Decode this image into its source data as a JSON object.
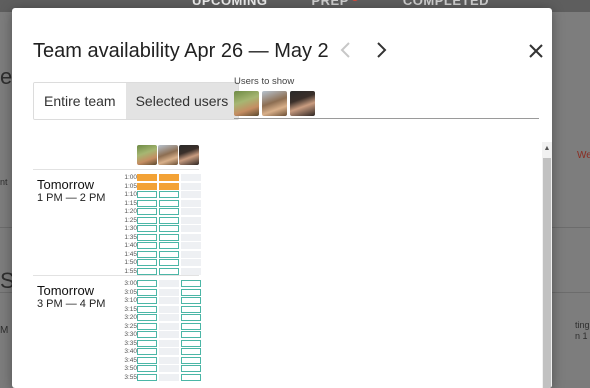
{
  "background": {
    "tabs": [
      {
        "label": "UPCOMING",
        "active": true
      },
      {
        "label": "PREP",
        "active": false,
        "badge": true
      },
      {
        "label": "COMPLETED",
        "active": false
      }
    ],
    "fragments": {
      "left_e": "e",
      "left_nt": "nt",
      "left_s": "S",
      "left_m": "M",
      "right_we": "We",
      "right_ting": "ting",
      "right_ting2": "n 1"
    }
  },
  "modal": {
    "title": "Team availability Apr 26 — May 2",
    "prev_icon": "chevron-left-icon",
    "next_icon": "chevron-right-icon",
    "close_icon": "close-icon",
    "toggle": {
      "entire_team": "Entire team",
      "selected_users": "Selected users",
      "selected": "selected_users"
    },
    "users_label": "Users to show",
    "users": [
      "user-1",
      "user-2",
      "user-3"
    ]
  },
  "colors": {
    "busy": "#f3a235",
    "free": "#4bb6a6",
    "none": "#eef0f3"
  },
  "schedule": [
    {
      "day": "Tomorrow",
      "range": "1 PM — 2 PM",
      "rows": [
        {
          "time": "1:00",
          "cells": [
            "busy",
            "busy",
            "none"
          ]
        },
        {
          "time": "1:05",
          "cells": [
            "busy",
            "busy",
            "none"
          ]
        },
        {
          "time": "1:10",
          "cells": [
            "free",
            "free",
            "none"
          ]
        },
        {
          "time": "1:15",
          "cells": [
            "free",
            "free",
            "none"
          ]
        },
        {
          "time": "1:20",
          "cells": [
            "free",
            "free",
            "none"
          ]
        },
        {
          "time": "1:25",
          "cells": [
            "free",
            "free",
            "none"
          ]
        },
        {
          "time": "1:30",
          "cells": [
            "free",
            "free",
            "none"
          ]
        },
        {
          "time": "1:35",
          "cells": [
            "free",
            "free",
            "none"
          ]
        },
        {
          "time": "1:40",
          "cells": [
            "free",
            "free",
            "none"
          ]
        },
        {
          "time": "1:45",
          "cells": [
            "free",
            "free",
            "none"
          ]
        },
        {
          "time": "1:50",
          "cells": [
            "free",
            "free",
            "none"
          ]
        },
        {
          "time": "1:55",
          "cells": [
            "free",
            "free",
            "none"
          ]
        }
      ]
    },
    {
      "day": "Tomorrow",
      "range": "3 PM — 4 PM",
      "rows": [
        {
          "time": "3:00",
          "cells": [
            "free",
            "none",
            "free"
          ]
        },
        {
          "time": "3:05",
          "cells": [
            "free",
            "none",
            "free"
          ]
        },
        {
          "time": "3:10",
          "cells": [
            "free",
            "none",
            "free"
          ]
        },
        {
          "time": "3:15",
          "cells": [
            "free",
            "none",
            "free"
          ]
        },
        {
          "time": "3:20",
          "cells": [
            "free",
            "none",
            "free"
          ]
        },
        {
          "time": "3:25",
          "cells": [
            "free",
            "none",
            "free"
          ]
        },
        {
          "time": "3:30",
          "cells": [
            "free",
            "none",
            "free"
          ]
        },
        {
          "time": "3:35",
          "cells": [
            "free",
            "none",
            "free"
          ]
        },
        {
          "time": "3:40",
          "cells": [
            "free",
            "none",
            "free"
          ]
        },
        {
          "time": "3:45",
          "cells": [
            "free",
            "none",
            "free"
          ]
        },
        {
          "time": "3:50",
          "cells": [
            "free",
            "none",
            "free"
          ]
        },
        {
          "time": "3:55",
          "cells": [
            "free",
            "none",
            "free"
          ]
        }
      ]
    }
  ]
}
